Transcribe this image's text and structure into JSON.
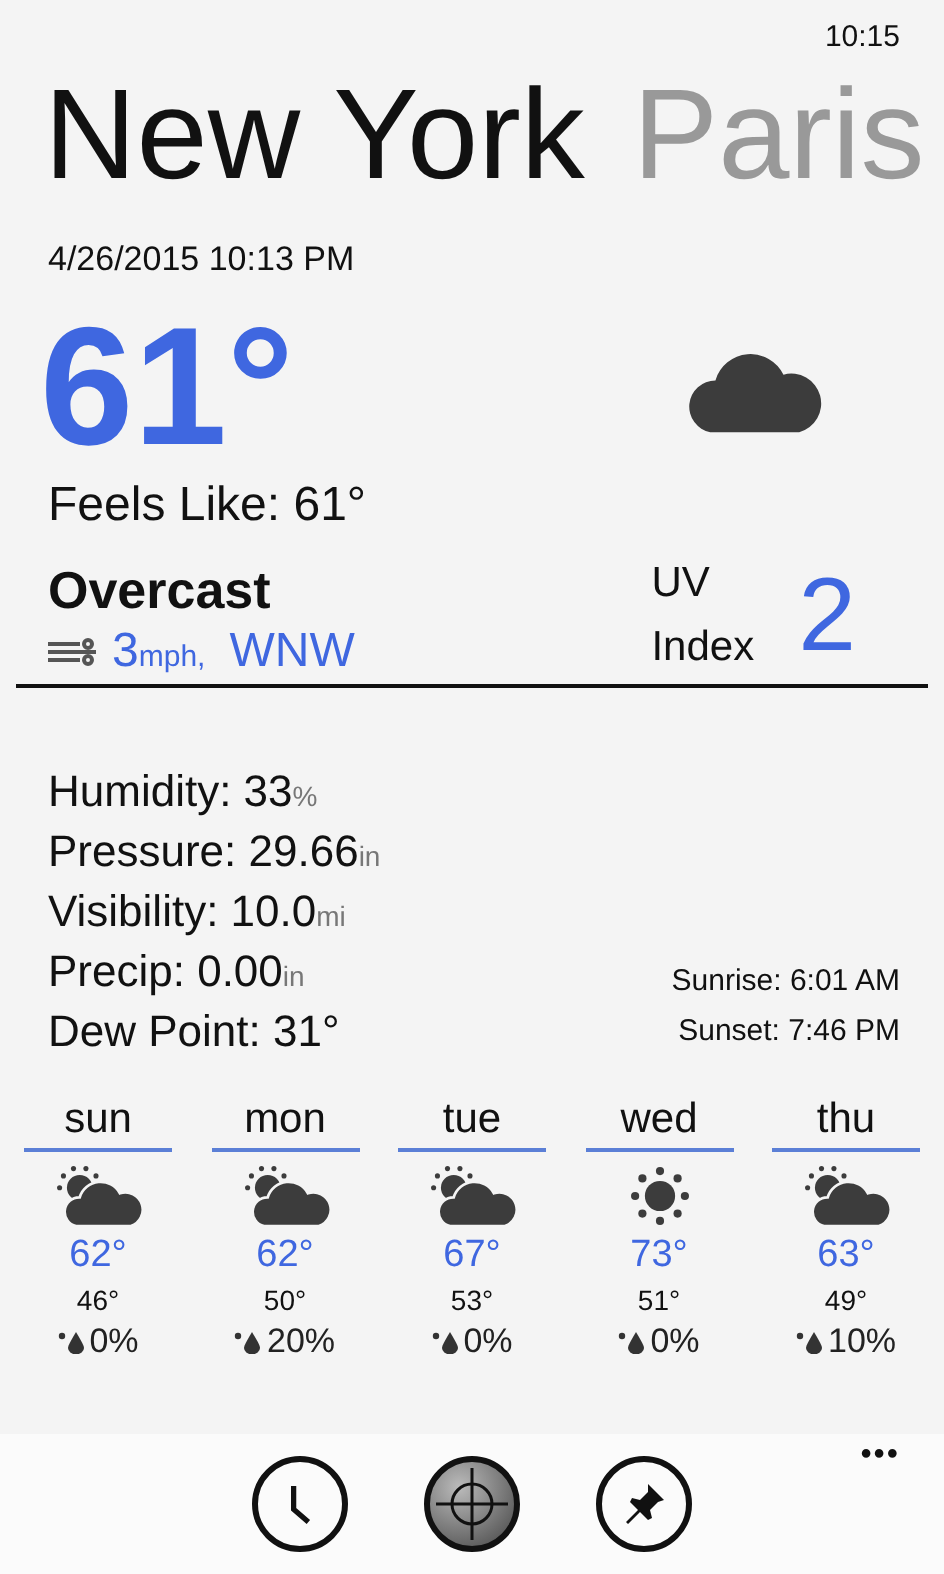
{
  "status_bar": {
    "time": "10:15"
  },
  "cities": [
    {
      "name": "New York",
      "selected": true
    },
    {
      "name": "Paris",
      "selected": false
    }
  ],
  "current": {
    "datetime": "4/26/2015 10:13 PM",
    "temperature": "61°",
    "feels_like": "Feels Like: 61°",
    "condition": "Overcast",
    "wind_speed": "3",
    "wind_unit": "mph,",
    "wind_direction": "WNW",
    "uv_label_1": "UV",
    "uv_label_2": "Index",
    "uv_value": "2"
  },
  "details": [
    {
      "label": "Humidity:",
      "value": "33",
      "unit": "%"
    },
    {
      "label": "Pressure:",
      "value": "29.66",
      "unit": "in"
    },
    {
      "label": "Visibility:",
      "value": "10.0",
      "unit": "mi"
    },
    {
      "label": "Precip:",
      "value": "0.00",
      "unit": "in"
    },
    {
      "label": "Dew Point:",
      "value": "31°"
    }
  ],
  "sun": {
    "sunrise": "Sunrise: 6:01 AM",
    "sunset": "Sunset:  7:46 PM"
  },
  "forecast": [
    {
      "day": "sun",
      "kind": "partly-cloudy",
      "high": "62°",
      "low": "46°",
      "precip": "0%"
    },
    {
      "day": "mon",
      "kind": "partly-cloudy",
      "high": "62°",
      "low": "50°",
      "precip": "20%"
    },
    {
      "day": "tue",
      "kind": "partly-cloudy",
      "high": "67°",
      "low": "53°",
      "precip": "0%"
    },
    {
      "day": "wed",
      "kind": "sunny",
      "high": "73°",
      "low": "51°",
      "precip": "0%"
    },
    {
      "day": "thu",
      "kind": "partly-cloudy",
      "high": "63°",
      "low": "49°",
      "precip": "10%"
    }
  ],
  "app_bar": {
    "more": "•••"
  }
}
